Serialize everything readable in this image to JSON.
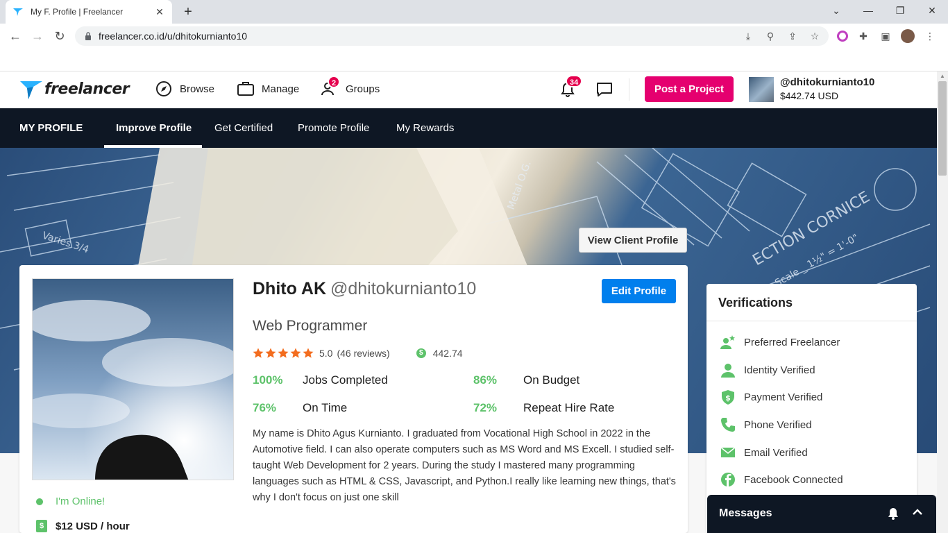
{
  "browser": {
    "tab_title": "My F. Profile | Freelancer",
    "url": "freelancer.co.id/u/dhitokurnianto10"
  },
  "header": {
    "logo_text": "freelancer",
    "nav": [
      {
        "label": "Browse",
        "icon": "compass-icon"
      },
      {
        "label": "Manage",
        "icon": "briefcase-icon"
      },
      {
        "label": "Groups",
        "icon": "users-icon",
        "badge": "2"
      }
    ],
    "notifications_count": "34",
    "post_project_label": "Post a Project",
    "username": "@dhitokurnianto10",
    "balance": "$442.74 USD",
    "accent_color": "#e5006f"
  },
  "subnav": {
    "items": [
      "MY PROFILE",
      "Improve Profile",
      "Get Certified",
      "Promote Profile",
      "My Rewards"
    ],
    "active": "Improve Profile"
  },
  "banner": {
    "view_client_label": "View Client Profile"
  },
  "profile": {
    "name": "Dhito AK",
    "handle": "@dhitokurnianto10",
    "edit_label": "Edit Profile",
    "tagline": "Web Programmer",
    "rating": "5.0",
    "reviews": "(46 reviews)",
    "stars": 5,
    "earnings": "442.74",
    "online_text": "I'm Online!",
    "hourly_rate": "$12 USD / hour",
    "stats": [
      {
        "pct": "100%",
        "label": "Jobs Completed"
      },
      {
        "pct": "86%",
        "label": "On Budget"
      },
      {
        "pct": "76%",
        "label": "On Time"
      },
      {
        "pct": "72%",
        "label": "Repeat Hire Rate"
      }
    ],
    "bio": "My name is Dhito Agus Kurnianto. I graduated from Vocational High School in 2022 in the Automotive field. I can also operate computers such as MS Word and MS Excell. I studied self-taught Web Development for 2 years. During the study I mastered many programming languages such as HTML & CSS, Javascript, and Python.I really like learning new things, that's why I don't focus on just one skill"
  },
  "verifications": {
    "title": "Verifications",
    "items": [
      {
        "label": "Preferred Freelancer",
        "icon": "preferred-freelancer-icon"
      },
      {
        "label": "Identity Verified",
        "icon": "identity-icon"
      },
      {
        "label": "Payment Verified",
        "icon": "payment-shield-icon"
      },
      {
        "label": "Phone Verified",
        "icon": "phone-icon"
      },
      {
        "label": "Email Verified",
        "icon": "email-icon"
      },
      {
        "label": "Facebook Connected",
        "icon": "facebook-icon"
      }
    ],
    "verified_color": "#5dc26a"
  },
  "messages": {
    "label": "Messages"
  }
}
